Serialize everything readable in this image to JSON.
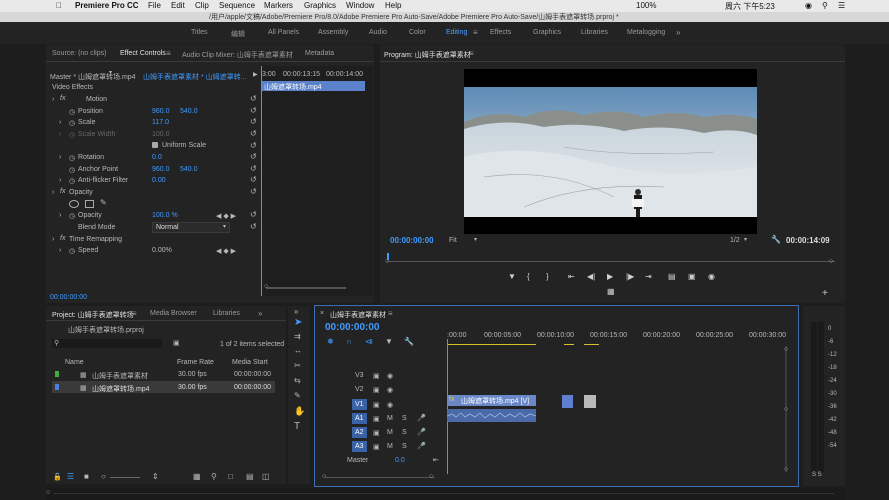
{
  "menubar": {
    "apple": "",
    "app": "Premiere Pro CC",
    "items": [
      "File",
      "Edit",
      "Clip",
      "Sequence",
      "Markers",
      "Graphics",
      "Window",
      "Help"
    ],
    "battery": "100%",
    "clock": "周六 下午5:23"
  },
  "title_path": "/用户/apple/文稿/Adobe/Premiere Pro/8.0/Adobe Premiere Pro Auto-Save/Adobe Premiere Pro Auto-Save/山姆手表遮罩转场.prproj *",
  "workspaces": [
    "Titles",
    "编辑",
    "All Panels",
    "Assembly",
    "Audio",
    "Color",
    "Editing",
    "Effects",
    "Graphics",
    "Libraries",
    "Metalogging"
  ],
  "source_panel": {
    "tabs": [
      "Source: (no clips)",
      "Effect Controls",
      "Audio Clip Mixer: 山姆手表遮罩素材",
      "Metadata"
    ],
    "master": "Master * 山姆遮罩转场.mp4",
    "sequence": "山姆手表遮罩素材 * 山姆遮罩转...",
    "ruler": [
      "3:00",
      "00:00:13:15",
      "00:00:14:00"
    ],
    "clip_label": "山姆遮罩转场.mp4",
    "video_effects": "Video Effects",
    "motion": "Motion",
    "position": {
      "label": "Position",
      "x": "960.0",
      "y": "540.0"
    },
    "scale": {
      "label": "Scale",
      "value": "117.0"
    },
    "scale_width": {
      "label": "Scale Width",
      "value": "100.0"
    },
    "uniform_scale": "Uniform Scale",
    "rotation": {
      "label": "Rotation",
      "value": "0.0"
    },
    "anchor": {
      "label": "Anchor Point",
      "x": "960.0",
      "y": "540.0"
    },
    "antiflicker": {
      "label": "Anti-flicker Filter",
      "value": "0.00"
    },
    "opacity_section": "Opacity",
    "opacity": {
      "label": "Opacity",
      "value": "100.0 %"
    },
    "blend": {
      "label": "Blend Mode",
      "value": "Normal"
    },
    "time_remap": "Time Remapping",
    "speed": {
      "label": "Speed",
      "value": "0.00%"
    },
    "timecode": "00:00:00:00"
  },
  "program": {
    "title": "Program: 山姆手表遮罩素材",
    "timecode": "00:00:00:00",
    "fit": "Fit",
    "res": "1/2",
    "duration": "00:00:14:09"
  },
  "project": {
    "tabs": [
      "Project: 山姆手表遮罩转场",
      "Media Browser",
      "Libraries"
    ],
    "filename": "山姆手表遮罩转场.prproj",
    "selected": "1 of 2 items selected",
    "headers": [
      "Name",
      "Frame Rate",
      "Media Start"
    ],
    "rows": [
      {
        "name": "山姆手表遮罩素材",
        "fps": "30.00 fps",
        "start": "00:00:00:00",
        "color": "#3fae3f"
      },
      {
        "name": "山姆遮罩转场.mp4",
        "fps": "30.00 fps",
        "start": "00:00:00:00",
        "color": "#4a7fe0"
      }
    ]
  },
  "timeline": {
    "title": "山姆手表遮罩素材",
    "timecode": "00:00:00:00",
    "ruler": [
      ":00:00",
      "00:00:05:00",
      "00:00:10:00",
      "00:00:15:00",
      "00:00:20:00",
      "00:00:25:00",
      "00:00:30:00"
    ],
    "tracks": [
      "V3",
      "V2",
      "V1",
      "A1",
      "A2",
      "A3"
    ],
    "master": "Master",
    "master_val": "0.0",
    "clip_label": "山姆遮罩转场.mp4 [V]"
  },
  "meter": [
    "0",
    "-6",
    "-12",
    "-18",
    "-24",
    "-30",
    "-36",
    "-42",
    "-48",
    "-54",
    "S S"
  ]
}
